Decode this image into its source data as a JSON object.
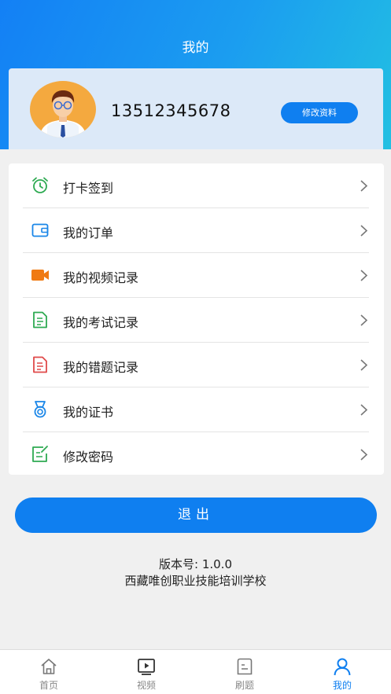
{
  "header": {
    "title": "我的"
  },
  "profile": {
    "phone": "13512345678",
    "edit_label": "修改资料"
  },
  "menu": {
    "items": [
      {
        "label": "打卡签到",
        "icon": "alarm-clock-icon",
        "color": "#2eaa52"
      },
      {
        "label": "我的订单",
        "icon": "wallet-icon",
        "color": "#1a86e8"
      },
      {
        "label": "我的视频记录",
        "icon": "video-camera-icon",
        "color": "#f07a12"
      },
      {
        "label": "我的考试记录",
        "icon": "document-icon",
        "color": "#2eaa52"
      },
      {
        "label": "我的错题记录",
        "icon": "document-icon",
        "color": "#e04a4a"
      },
      {
        "label": "我的证书",
        "icon": "medal-icon",
        "color": "#1a86e8"
      },
      {
        "label": "修改密码",
        "icon": "edit-note-icon",
        "color": "#2eaa52"
      }
    ]
  },
  "logout": {
    "label": "退出"
  },
  "footer": {
    "version": "版本号: 1.0.0",
    "school": "西藏唯创职业技能培训学校"
  },
  "tabbar": {
    "tabs": [
      {
        "label": "首页",
        "icon": "home-icon"
      },
      {
        "label": "视频",
        "icon": "video-play-icon"
      },
      {
        "label": "刷题",
        "icon": "quiz-icon"
      },
      {
        "label": "我的",
        "icon": "user-icon",
        "active": true
      }
    ]
  },
  "colors": {
    "primary": "#0f7ff0",
    "header_start": "#1380f5",
    "header_end": "#22c0e2"
  }
}
